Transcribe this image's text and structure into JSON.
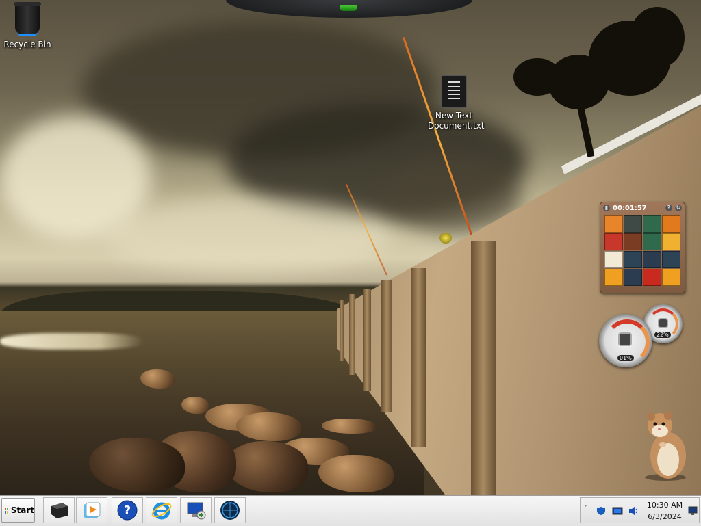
{
  "desktop": {
    "icons": [
      {
        "label": "Recycle Bin",
        "icon": "recycle-bin-icon"
      },
      {
        "label": "New Text Document.txt",
        "icon": "text-document-icon"
      }
    ]
  },
  "puzzle_gadget": {
    "timer": "00:01:57",
    "help_label": "?",
    "tiles": [
      "#e8842a",
      "#3f4a46",
      "#2f6a4c",
      "#e07a1c",
      "#c8382a",
      "#7a3c22",
      "#2f6a4c",
      "#f0b030",
      "#f2ead4",
      "#2c4456",
      "#2c3c50",
      "#2c4456",
      "#f0a020",
      "#2c3c50",
      "#c82a20",
      "#f0a020"
    ]
  },
  "meter_gadget": {
    "cpu_percent": "01%",
    "memory_percent": "22%"
  },
  "taskbar": {
    "start_label": "Start",
    "pinned": [
      {
        "name": "show-desktop",
        "icon": "monitor-black-icon"
      },
      {
        "name": "media-player",
        "icon": "media-player-icon"
      },
      {
        "name": "help",
        "icon": "help-icon"
      },
      {
        "name": "internet-explorer",
        "icon": "ie-icon"
      },
      {
        "name": "remote-desktop",
        "icon": "remote-desktop-icon"
      },
      {
        "name": "globe",
        "icon": "globe-icon"
      }
    ],
    "tray": {
      "time": "10:30 AM",
      "date": "6/3/2024"
    }
  },
  "colors": {
    "taskbar": "#ececec",
    "dock_led": "#3cb52c",
    "accent_blue": "#1e90ff"
  }
}
